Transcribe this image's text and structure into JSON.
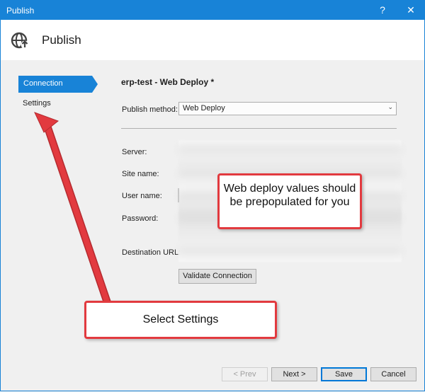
{
  "window": {
    "title": "Publish",
    "help_label": "?",
    "close_label": "✕",
    "accent": "#1883d7"
  },
  "header": {
    "title": "Publish",
    "icon": "globe-publish-icon"
  },
  "nav": {
    "items": [
      {
        "label": "Connection",
        "selected": true
      },
      {
        "label": "Settings",
        "selected": false
      }
    ]
  },
  "main": {
    "profile_title": "erp-test - Web Deploy *",
    "publish_method_label": "Publish method:",
    "publish_method_value": "Web Deploy",
    "fields": [
      {
        "label": "Server:"
      },
      {
        "label": "Site name:"
      },
      {
        "label": "User name:"
      },
      {
        "label": "Password:"
      },
      {
        "label": "Destination URL:"
      }
    ],
    "validate_label": "Validate Connection"
  },
  "footer": {
    "prev_label": "< Prev",
    "next_label": "Next >",
    "save_label": "Save",
    "cancel_label": "Cancel"
  },
  "annotations": {
    "values_callout": "Web deploy values should be prepopulated for you",
    "settings_callout": "Select Settings",
    "annotation_color": "#e23a3f"
  }
}
